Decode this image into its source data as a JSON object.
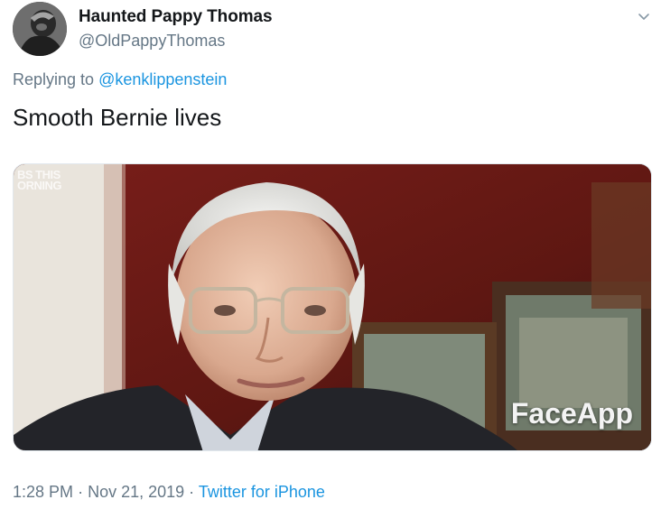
{
  "author": {
    "display_name": "Haunted Pappy Thomas",
    "handle": "@OldPappyThomas"
  },
  "reply": {
    "prefix": "Replying to",
    "mention": "@kenklippenstein"
  },
  "tweet": {
    "text": "Smooth Bernie lives"
  },
  "media": {
    "watermark": "FaceApp",
    "corner_logo_line1": "BS THIS",
    "corner_logo_line2": "ORNING"
  },
  "meta": {
    "time": "1:28 PM",
    "separator": "·",
    "date": "Nov 21, 2019",
    "source": "Twitter for iPhone"
  },
  "colors": {
    "text": "#14171a",
    "secondary": "#657786",
    "link": "#1b95e0"
  },
  "icons": {
    "caret": "chevron-down-icon",
    "avatar": "avatar"
  }
}
